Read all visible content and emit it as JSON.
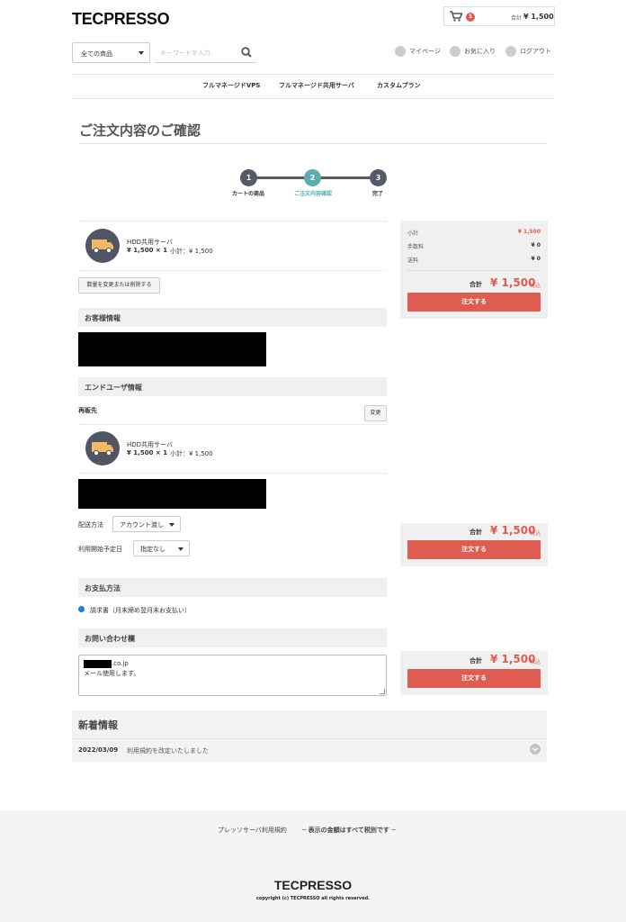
{
  "header": {
    "logo": "TECPRESSO",
    "cart": {
      "count": "1",
      "total_label": "合計",
      "total_value": "¥ 1,500"
    },
    "category_select": "全ての商品",
    "search_placeholder": "キーワードを入力",
    "links": {
      "mypage": "マイページ",
      "favorites": "お気に入り",
      "logout": "ログアウト"
    }
  },
  "global_nav": [
    "フルマネージドVPS",
    "フルマネージド共用サーバ",
    "カスタムプラン"
  ],
  "page_title": "ご注文内容のご確認",
  "steps": [
    {
      "num": "1",
      "label": "カートの商品"
    },
    {
      "num": "2",
      "label": "ご注文内容確認"
    },
    {
      "num": "3",
      "label": "完了"
    }
  ],
  "cart_item": {
    "name": "HDD共用サーバ",
    "qty_price": "¥ 1,500 × 1",
    "subtotal": "小計：¥ 1,500"
  },
  "change_qty_button": "数量を変更または削除する",
  "sections": {
    "customer": "お客様情報",
    "enduser": "エンドユーザ情報",
    "payment": "お支払方法",
    "inquiry": "お問い合わせ欄"
  },
  "resale_label": "再販先",
  "change_button": "変更",
  "delivery": {
    "label": "配送方法",
    "value": "アカウント渡し"
  },
  "start_date": {
    "label": "利用開始予定日",
    "value": "指定なし"
  },
  "payment_option": "請求書（月末締め翌月末お支払い）",
  "inquiry_text": {
    "line1": ".co.jp",
    "line2": "メール使用します。"
  },
  "summary": {
    "subtotal_label": "小計",
    "subtotal_value": "¥ 1,500",
    "fee_label": "手数料",
    "fee_value": "¥ 0",
    "shipping_label": "送料",
    "shipping_value": "¥ 0",
    "total_label": "合計",
    "total_value": "¥ 1,500",
    "tax_label": "税込",
    "order_button": "注文する"
  },
  "news": {
    "title": "新着情報",
    "items": [
      {
        "date": "2022/03/09",
        "text": "利用規約を改定いたしました"
      }
    ]
  },
  "footer": {
    "terms_link": "プレッソサーバ利用規約",
    "tax_note": "─ 表示の金額はすべて税別です ─",
    "logo": "TECPRESSO",
    "copyright": "copyright (c) TECPRESSO all rights reserved."
  },
  "colors": {
    "accent": "#de5d50",
    "step_active": "#5aaeae",
    "step_default": "#555a66"
  }
}
